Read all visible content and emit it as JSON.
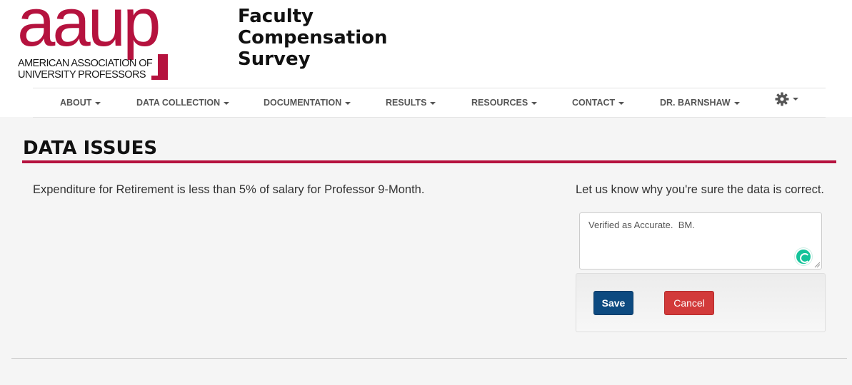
{
  "logo": {
    "wordmark": "aaup",
    "line1": "AMERICAN ASSOCIATION OF",
    "line2": "UNIVERSITY PROFESSORS"
  },
  "site_title": [
    "Faculty",
    "Compensation",
    "Survey"
  ],
  "nav": {
    "items": [
      {
        "label": "ABOUT"
      },
      {
        "label": "DATA COLLECTION"
      },
      {
        "label": "DOCUMENTATION"
      },
      {
        "label": "RESULTS"
      },
      {
        "label": "RESOURCES"
      },
      {
        "label": "CONTACT"
      },
      {
        "label": "DR. BARNSHAW"
      }
    ],
    "settings_icon": "gear-icon"
  },
  "page": {
    "title": "DATA ISSUES",
    "issue": "Expenditure for Retirement is less than 5% of salary for Professor 9-Month.",
    "prompt": "Let us know why you're sure the data is correct.",
    "comment_value": "Verified as Accurate.  BM."
  },
  "actions": {
    "save_label": "Save",
    "cancel_label": "Cancel"
  },
  "colors": {
    "brand": "#b5123e",
    "save": "#0d4a80",
    "cancel": "#d23a3a",
    "grammarly": "#15c39a"
  }
}
